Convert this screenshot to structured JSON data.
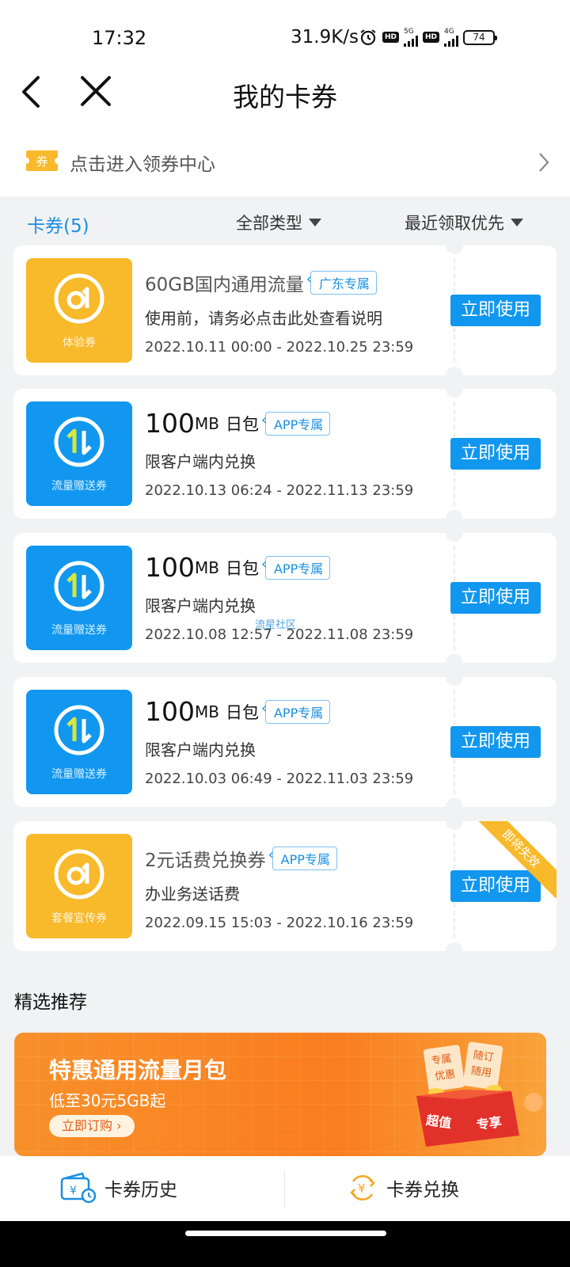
{
  "status_bar": {
    "time": "17:32",
    "net_speed": "31.9K/s",
    "hd1": "HD",
    "sim1": "5G",
    "hd2": "HD",
    "sim2": "4G",
    "battery": "74"
  },
  "nav": {
    "title": "我的卡券"
  },
  "coupon_center": {
    "icon_text": "券",
    "label": "点击进入领券中心"
  },
  "filter": {
    "count_label": "卡券(5)",
    "type_label": "全部类型",
    "sort_label": "最近领取优先"
  },
  "cards": [
    {
      "thumb_label": "体验券",
      "title": "60GB国内通用流量",
      "tag": "广东专属",
      "desc": "使用前，请务必点击此处查看说明",
      "date": "2022.10.11 00:00 - 2022.10.25 23:59",
      "button": "立即使用"
    },
    {
      "thumb_label": "流量赠送券",
      "title_num": "100",
      "title_unit": "MB",
      "title_sub": "日包",
      "tag": "APP专属",
      "desc": "限客户端内兑换",
      "date": "2022.10.13 06:24 - 2022.11.13 23:59",
      "button": "立即使用"
    },
    {
      "thumb_label": "流量赠送券",
      "title_num": "100",
      "title_unit": "MB",
      "title_sub": "日包",
      "tag": "APP专属",
      "desc": "限客户端内兑换",
      "date": "2022.10.08 12:57 - 2022.11.08 23:59",
      "button": "立即使用"
    },
    {
      "thumb_label": "流量赠送券",
      "title_num": "100",
      "title_unit": "MB",
      "title_sub": "日包",
      "tag": "APP专属",
      "desc": "限客户端内兑换",
      "date": "2022.10.03 06:49 - 2022.11.03 23:59",
      "button": "立即使用"
    },
    {
      "thumb_label": "套餐宣传券",
      "title": "2元话费兑换券",
      "tag": "APP专属",
      "desc": "办业务送话费",
      "date": "2022.09.15 15:03 - 2022.10.16 23:59",
      "button": "立即使用",
      "ribbon": "即将失效"
    }
  ],
  "watermark": "流星社区",
  "recommend": {
    "section_title": "精选推荐",
    "banner_title": "特惠通用流量月包",
    "banner_sub": "低至30元5GB起",
    "banner_button": "立即订购 ›",
    "art_texts": [
      "专属",
      "优惠",
      "随订",
      "随用",
      "超值",
      "专享"
    ]
  },
  "bottom_bar": {
    "history": "卡券历史",
    "exchange": "卡券兑换"
  },
  "colors": {
    "primary_blue": "#1197ef",
    "coupon_yellow": "#f8b92a",
    "banner_orange": "#fa7d1f"
  }
}
